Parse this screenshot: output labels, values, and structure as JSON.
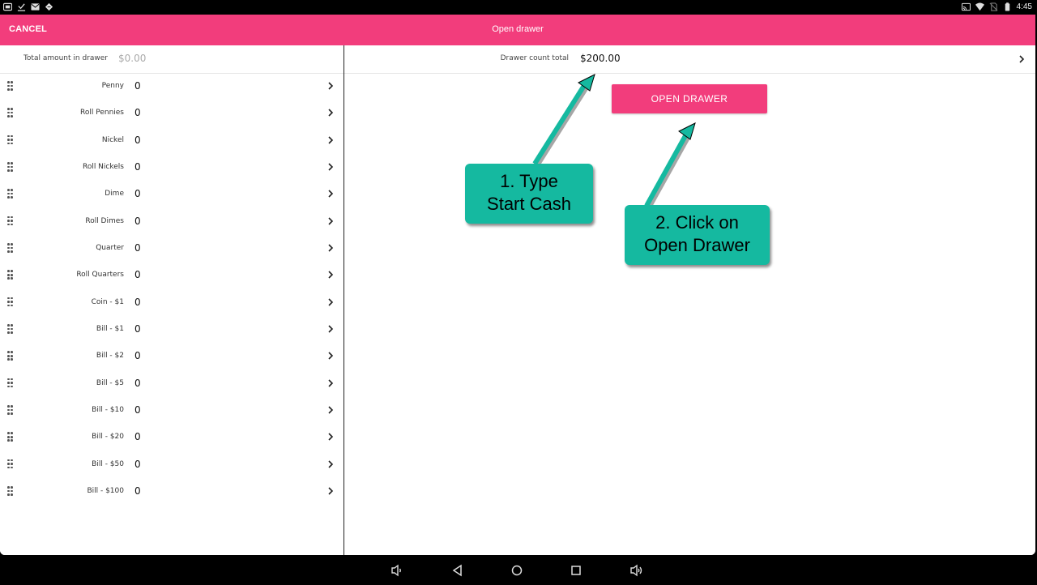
{
  "status_bar": {
    "left_icons": [
      "screen-cast-icon",
      "download-done-icon",
      "mail-icon",
      "code-icon"
    ],
    "right_icons": [
      "cast-icon",
      "wifi-icon",
      "no-sim-icon",
      "battery-icon"
    ],
    "time": "4:45"
  },
  "app_bar": {
    "cancel_label": "CANCEL",
    "title": "Open drawer"
  },
  "left_panel": {
    "total_label": "Total amount in drawer",
    "total_value": "$0.00",
    "denominations": [
      {
        "label": "Penny",
        "value": "0"
      },
      {
        "label": "Roll Pennies",
        "value": "0"
      },
      {
        "label": "Nickel",
        "value": "0"
      },
      {
        "label": "Roll Nickels",
        "value": "0"
      },
      {
        "label": "Dime",
        "value": "0"
      },
      {
        "label": "Roll Dimes",
        "value": "0"
      },
      {
        "label": "Quarter",
        "value": "0"
      },
      {
        "label": "Roll Quarters",
        "value": "0"
      },
      {
        "label": "Coin - $1",
        "value": "0"
      },
      {
        "label": "Bill - $1",
        "value": "0"
      },
      {
        "label": "Bill - $2",
        "value": "0"
      },
      {
        "label": "Bill - $5",
        "value": "0"
      },
      {
        "label": "Bill - $10",
        "value": "0"
      },
      {
        "label": "Bill - $20",
        "value": "0"
      },
      {
        "label": "Bill - $50",
        "value": "0"
      },
      {
        "label": "Bill - $100",
        "value": "0"
      }
    ]
  },
  "right_panel": {
    "drawer_count_label": "Drawer count total",
    "drawer_count_value": "$200.00",
    "open_drawer_label": "OPEN DRAWER"
  },
  "callouts": [
    {
      "line1": "1. Type",
      "line2": "Start Cash"
    },
    {
      "line1": "2. Click on",
      "line2": "Open Drawer"
    }
  ],
  "colors": {
    "accent": "#f23d7c",
    "callout": "#15b9a0"
  },
  "nav_bar": {
    "icons": [
      "volume-down-icon",
      "back-icon",
      "home-icon",
      "recents-icon",
      "volume-up-icon"
    ]
  }
}
